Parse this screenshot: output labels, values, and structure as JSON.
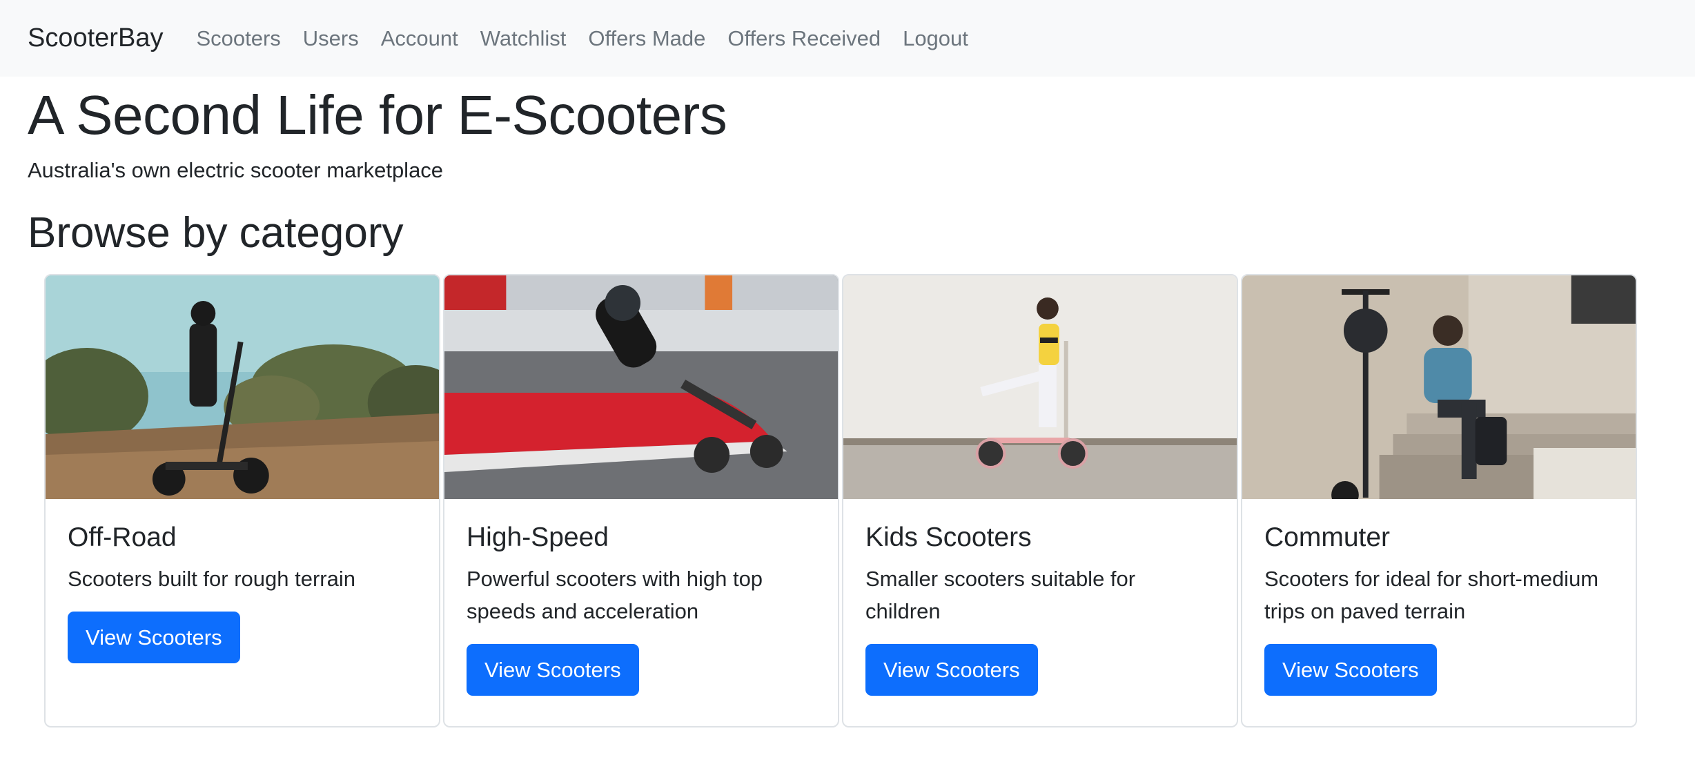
{
  "navbar": {
    "brand": "ScooterBay",
    "links": [
      "Scooters",
      "Users",
      "Account",
      "Watchlist",
      "Offers Made",
      "Offers Received",
      "Logout"
    ]
  },
  "hero": {
    "title": "A Second Life for E-Scooters",
    "subtitle": "Australia's own electric scooter marketplace"
  },
  "browse": {
    "title": "Browse by category",
    "categories": [
      {
        "title": "Off-Road",
        "text": "Scooters built for rough terrain",
        "button": "View Scooters"
      },
      {
        "title": "High-Speed",
        "text": "Powerful scooters with high top speeds and acceleration",
        "button": "View Scooters"
      },
      {
        "title": "Kids Scooters",
        "text": "Smaller scooters suitable for children",
        "button": "View Scooters"
      },
      {
        "title": "Commuter",
        "text": "Scooters for ideal for short-medium trips on paved terrain",
        "button": "View Scooters"
      }
    ]
  },
  "colors": {
    "primary": "#0d6efd",
    "navbar_bg": "#f8f9fa",
    "nav_link": "#6c757d",
    "text": "#212529"
  }
}
